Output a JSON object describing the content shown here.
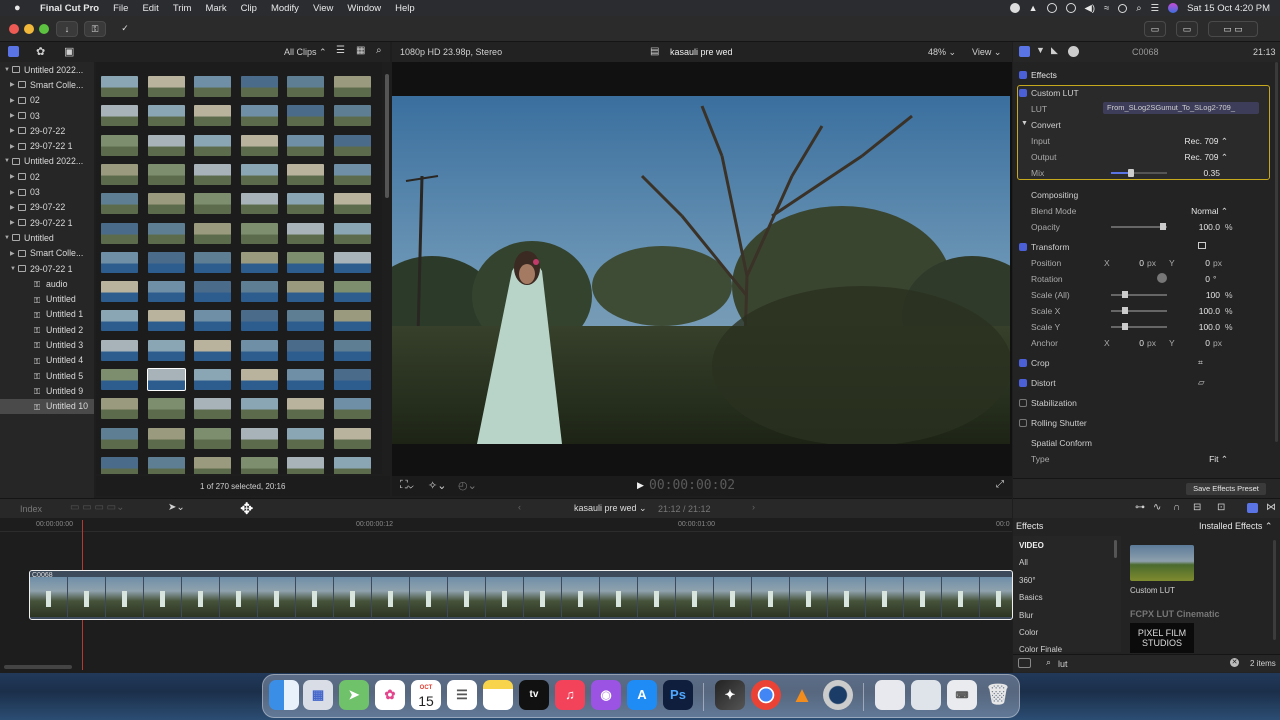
{
  "menubar": {
    "apple": "",
    "app_name": "Final Cut Pro",
    "items": [
      "File",
      "Edit",
      "Trim",
      "Mark",
      "Clip",
      "Modify",
      "View",
      "Window",
      "Help"
    ],
    "datetime": "Sat 15 Oct  4:20 PM"
  },
  "browser": {
    "filter": "All Clips",
    "selection_status": "1 of 270 selected, 20:16",
    "sidebar": [
      {
        "label": "Untitled 2022...",
        "level": 0,
        "open": true,
        "type": "library"
      },
      {
        "label": "Smart Colle...",
        "level": 1,
        "open": false,
        "type": "folder"
      },
      {
        "label": "02",
        "level": 1,
        "open": false,
        "type": "event"
      },
      {
        "label": "03",
        "level": 1,
        "open": false,
        "type": "event"
      },
      {
        "label": "29-07-22",
        "level": 1,
        "open": false,
        "type": "event"
      },
      {
        "label": "29-07-22 1",
        "level": 1,
        "open": false,
        "type": "event"
      },
      {
        "label": "Untitled 2022...",
        "level": 0,
        "open": true,
        "type": "library"
      },
      {
        "label": "02",
        "level": 1,
        "open": false,
        "type": "event"
      },
      {
        "label": "03",
        "level": 1,
        "open": false,
        "type": "event"
      },
      {
        "label": "29-07-22",
        "level": 1,
        "open": false,
        "type": "event"
      },
      {
        "label": "29-07-22 1",
        "level": 1,
        "open": false,
        "type": "event"
      },
      {
        "label": "Untitled",
        "level": 0,
        "open": true,
        "type": "library"
      },
      {
        "label": "Smart Colle...",
        "level": 1,
        "open": false,
        "type": "folder"
      },
      {
        "label": "29-07-22 1",
        "level": 1,
        "open": true,
        "type": "event"
      },
      {
        "label": "audio",
        "level": 2,
        "type": "keyword"
      },
      {
        "label": "Untitled",
        "level": 2,
        "type": "keyword"
      },
      {
        "label": "Untitled 1",
        "level": 2,
        "type": "keyword"
      },
      {
        "label": "Untitled 2",
        "level": 2,
        "type": "keyword"
      },
      {
        "label": "Untitled 3",
        "level": 2,
        "type": "keyword"
      },
      {
        "label": "Untitled 4",
        "level": 2,
        "type": "keyword"
      },
      {
        "label": "Untitled 5",
        "level": 2,
        "type": "keyword"
      },
      {
        "label": "Untitled 9",
        "level": 2,
        "type": "keyword"
      },
      {
        "label": "Untitled 10",
        "level": 2,
        "type": "keyword",
        "selected": true
      }
    ]
  },
  "viewer": {
    "format": "1080p HD 23.98p, Stereo",
    "project": "kasauli pre wed",
    "zoom": "48%",
    "view_label": "View",
    "timecode": "00:00:00:02"
  },
  "inspector": {
    "clip_name": "C0068",
    "duration": "21:13",
    "effects_label": "Effects",
    "custom_lut": "Custom LUT",
    "lut_label": "LUT",
    "lut_value": "From_SLog2SGumut_To_SLog2-709_",
    "convert_label": "Convert",
    "input_label": "Input",
    "input_value": "Rec. 709",
    "output_label": "Output",
    "output_value": "Rec. 709",
    "mix_label": "Mix",
    "mix_value": "0.35",
    "mix_level": 0.35,
    "compositing_label": "Compositing",
    "blend_label": "Blend Mode",
    "blend_value": "Normal",
    "opacity_label": "Opacity",
    "opacity_value": "100.0",
    "opacity_unit": "%",
    "transform_label": "Transform",
    "position_label": "Position",
    "position_x": "0",
    "position_y": "0",
    "rotation_label": "Rotation",
    "rotation_value": "0",
    "rotation_unit": "°",
    "scale_all_label": "Scale (All)",
    "scale_all_value": "100",
    "scale_x_label": "Scale X",
    "scale_x_value": "100.0",
    "scale_y_label": "Scale Y",
    "scale_y_value": "100.0",
    "anchor_label": "Anchor",
    "anchor_x": "0",
    "anchor_y": "0",
    "px": "px",
    "x": "X",
    "y": "Y",
    "crop_label": "Crop",
    "distort_label": "Distort",
    "stabilization_label": "Stabilization",
    "rolling_shutter_label": "Rolling Shutter",
    "spatial_label": "Spatial Conform",
    "type_label": "Type",
    "type_value": "Fit",
    "save_preset": "Save Effects Preset"
  },
  "timeline": {
    "index": "Index",
    "project": "kasauli pre wed",
    "duration": "21:12 / 21:12",
    "ruler": [
      "00:00:00:00",
      "00:00:00:12",
      "00:00:01:00",
      "00:0"
    ],
    "clip_name": "C0068"
  },
  "effects_browser": {
    "title": "Effects",
    "installed": "Installed Effects",
    "categories": [
      "VIDEO",
      "All",
      "360°",
      "Basics",
      "Blur",
      "Color",
      "Color Finale"
    ],
    "item_name": "Custom LUT",
    "section": "FCPX LUT Cinematic",
    "pixel_film": "PIXEL FILM STUDIOS",
    "search_value": "lut",
    "count": "2 items"
  },
  "dock": {
    "calendar_month": "OCT",
    "calendar_day": "15",
    "tv_label": "tv",
    "ps_label": "Ps"
  }
}
